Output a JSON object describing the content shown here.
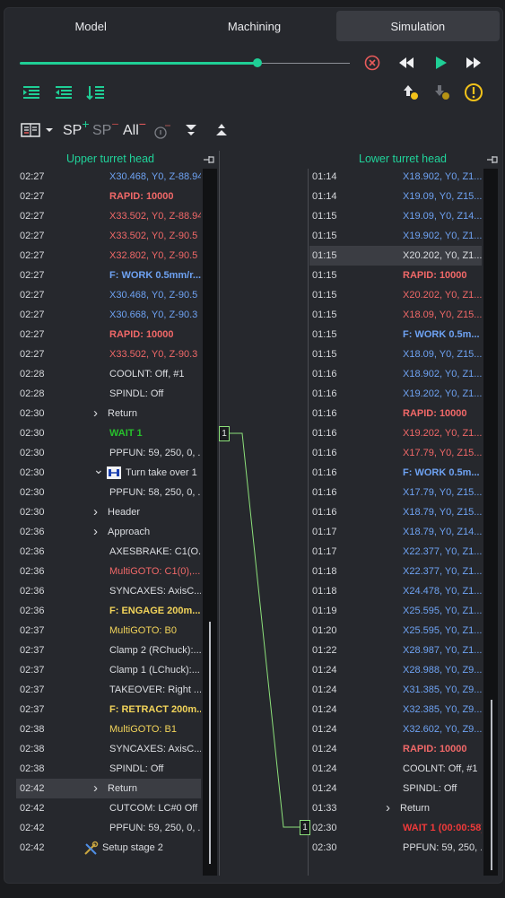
{
  "tabs": [
    {
      "label": "Model",
      "active": false
    },
    {
      "label": "Machining",
      "active": false
    },
    {
      "label": "Simulation",
      "active": true
    }
  ],
  "playback": {
    "progress": 0.72
  },
  "toolbar2": {
    "sp_add": "SP",
    "sp_remove": "SP",
    "all": "All"
  },
  "left": {
    "header": "Upper turret head",
    "rows": [
      {
        "t": "02:27",
        "text": "X30.468, Y0, Z-88.94",
        "cls": "c-blue"
      },
      {
        "t": "02:27",
        "text": "RAPID: 10000",
        "cls": "c-rfast"
      },
      {
        "t": "02:27",
        "text": "X33.502, Y0, Z-88.94",
        "cls": "c-red"
      },
      {
        "t": "02:27",
        "text": "X33.502, Y0, Z-90.5",
        "cls": "c-red"
      },
      {
        "t": "02:27",
        "text": "X32.802, Y0, Z-90.5",
        "cls": "c-red"
      },
      {
        "t": "02:27",
        "text": "F: WORK 0.5mm/r...",
        "cls": "c-bold-blue"
      },
      {
        "t": "02:27",
        "text": "X30.468, Y0, Z-90.5",
        "cls": "c-blue"
      },
      {
        "t": "02:27",
        "text": "X30.668, Y0, Z-90.3",
        "cls": "c-blue"
      },
      {
        "t": "02:27",
        "text": "RAPID: 10000",
        "cls": "c-rfast"
      },
      {
        "t": "02:27",
        "text": "X33.502, Y0, Z-90.3",
        "cls": "c-red"
      },
      {
        "t": "02:28",
        "text": "COOLNT: Off, #1",
        "cls": "c-white"
      },
      {
        "t": "02:28",
        "text": "SPINDL: Off",
        "cls": "c-white"
      },
      {
        "t": "02:30",
        "text": "Return",
        "cls": "c-white",
        "chev": "right",
        "indent": 1
      },
      {
        "t": "02:30",
        "text": "WAIT 1",
        "cls": "c-bold-green"
      },
      {
        "t": "02:30",
        "text": "PPFUN: 59, 250, 0, ...",
        "cls": "c-white"
      },
      {
        "t": "02:30",
        "text": "Turn take over 1",
        "cls": "c-white",
        "chev": "down",
        "icon": "turn",
        "indent": 1
      },
      {
        "t": "02:30",
        "text": "PPFUN: 58, 250, 0, ...",
        "cls": "c-white"
      },
      {
        "t": "02:30",
        "text": "Header",
        "cls": "c-white",
        "chev": "right",
        "indent": 2
      },
      {
        "t": "02:36",
        "text": "Approach",
        "cls": "c-white",
        "chev": "right",
        "indent": 2
      },
      {
        "t": "02:36",
        "text": "AXESBRAKE: C1(O...",
        "cls": "c-white"
      },
      {
        "t": "02:36",
        "text": "MultiGOTO: C1(0),...",
        "cls": "c-red"
      },
      {
        "t": "02:36",
        "text": "SYNCAXES: AxisC...",
        "cls": "c-white"
      },
      {
        "t": "02:36",
        "text": "F: ENGAGE 200m...",
        "cls": "c-bold-yellow"
      },
      {
        "t": "02:37",
        "text": "MultiGOTO: B0",
        "cls": "c-yellow"
      },
      {
        "t": "02:37",
        "text": "Clamp 2 (RChuck):...",
        "cls": "c-white"
      },
      {
        "t": "02:37",
        "text": "Clamp 1 (LChuck):...",
        "cls": "c-white"
      },
      {
        "t": "02:37",
        "text": "TAKEOVER: Right ...",
        "cls": "c-white"
      },
      {
        "t": "02:37",
        "text": "F: RETRACT 200m...",
        "cls": "c-bold-yellow"
      },
      {
        "t": "02:38",
        "text": "MultiGOTO: B1",
        "cls": "c-yellow"
      },
      {
        "t": "02:38",
        "text": "SYNCAXES: AxisC...",
        "cls": "c-white"
      },
      {
        "t": "02:38",
        "text": "SPINDL: Off",
        "cls": "c-white"
      },
      {
        "t": "02:42",
        "text": "Return",
        "cls": "c-white",
        "chev": "right",
        "indent": 2,
        "sel": true
      },
      {
        "t": "02:42",
        "text": "CUTCOM: LC#0 Off",
        "cls": "c-white"
      },
      {
        "t": "02:42",
        "text": "PPFUN: 59, 250, 0, ...",
        "cls": "c-white"
      },
      {
        "t": "02:42",
        "text": "Setup stage 2",
        "cls": "c-white",
        "icon": "tools",
        "indent": 0
      }
    ]
  },
  "right": {
    "header": "Lower turret head",
    "rows": [
      {
        "t": "01:14",
        "text": "X18.902, Y0, Z1...",
        "cls": "c-blue"
      },
      {
        "t": "01:14",
        "text": "X19.09, Y0, Z15...",
        "cls": "c-blue"
      },
      {
        "t": "01:15",
        "text": "X19.09, Y0, Z14...",
        "cls": "c-blue"
      },
      {
        "t": "01:15",
        "text": "X19.902, Y0, Z1...",
        "cls": "c-blue"
      },
      {
        "t": "01:15",
        "text": "X20.202, Y0, Z1...",
        "cls": "c-white",
        "sel": true
      },
      {
        "t": "01:15",
        "text": "RAPID: 10000",
        "cls": "c-rfast"
      },
      {
        "t": "01:15",
        "text": "X20.202, Y0, Z1...",
        "cls": "c-red"
      },
      {
        "t": "01:15",
        "text": "X18.09, Y0, Z15...",
        "cls": "c-red"
      },
      {
        "t": "01:15",
        "text": "F: WORK 0.5m...",
        "cls": "c-bold-blue"
      },
      {
        "t": "01:15",
        "text": "X18.09, Y0, Z15...",
        "cls": "c-blue"
      },
      {
        "t": "01:16",
        "text": "X18.902, Y0, Z1...",
        "cls": "c-blue"
      },
      {
        "t": "01:16",
        "text": "X19.202, Y0, Z1...",
        "cls": "c-blue"
      },
      {
        "t": "01:16",
        "text": "RAPID: 10000",
        "cls": "c-rfast"
      },
      {
        "t": "01:16",
        "text": "X19.202, Y0, Z1...",
        "cls": "c-red"
      },
      {
        "t": "01:16",
        "text": "X17.79, Y0, Z15...",
        "cls": "c-red"
      },
      {
        "t": "01:16",
        "text": "F: WORK 0.5m...",
        "cls": "c-bold-blue"
      },
      {
        "t": "01:16",
        "text": "X17.79, Y0, Z15...",
        "cls": "c-blue"
      },
      {
        "t": "01:16",
        "text": "X18.79, Y0, Z15...",
        "cls": "c-blue"
      },
      {
        "t": "01:17",
        "text": "X18.79, Y0, Z14...",
        "cls": "c-blue"
      },
      {
        "t": "01:17",
        "text": "X22.377, Y0, Z1...",
        "cls": "c-blue"
      },
      {
        "t": "01:18",
        "text": "X22.377, Y0, Z1...",
        "cls": "c-blue"
      },
      {
        "t": "01:18",
        "text": "X24.478, Y0, Z1...",
        "cls": "c-blue"
      },
      {
        "t": "01:19",
        "text": "X25.595, Y0, Z1...",
        "cls": "c-blue"
      },
      {
        "t": "01:20",
        "text": "X25.595, Y0, Z1...",
        "cls": "c-blue"
      },
      {
        "t": "01:22",
        "text": "X28.987, Y0, Z1...",
        "cls": "c-blue"
      },
      {
        "t": "01:24",
        "text": "X28.988, Y0, Z9...",
        "cls": "c-blue"
      },
      {
        "t": "01:24",
        "text": "X31.385, Y0, Z9...",
        "cls": "c-blue"
      },
      {
        "t": "01:24",
        "text": "X32.385, Y0, Z9...",
        "cls": "c-blue"
      },
      {
        "t": "01:24",
        "text": "X32.602, Y0, Z9...",
        "cls": "c-blue"
      },
      {
        "t": "01:24",
        "text": "RAPID: 10000",
        "cls": "c-rfast"
      },
      {
        "t": "01:24",
        "text": "COOLNT: Off, #1",
        "cls": "c-white"
      },
      {
        "t": "01:24",
        "text": "SPINDL: Off",
        "cls": "c-white"
      },
      {
        "t": "01:33",
        "text": "Return",
        "cls": "c-white",
        "chev": "right",
        "indent": 1
      },
      {
        "t": "02:30",
        "text": "WAIT 1 (00:00:58)",
        "cls": "c-bold-red"
      },
      {
        "t": "02:30",
        "text": "PPFUN: 59, 250, ...",
        "cls": "c-white"
      }
    ]
  },
  "sync": {
    "left_label": "1",
    "right_label": "1"
  }
}
